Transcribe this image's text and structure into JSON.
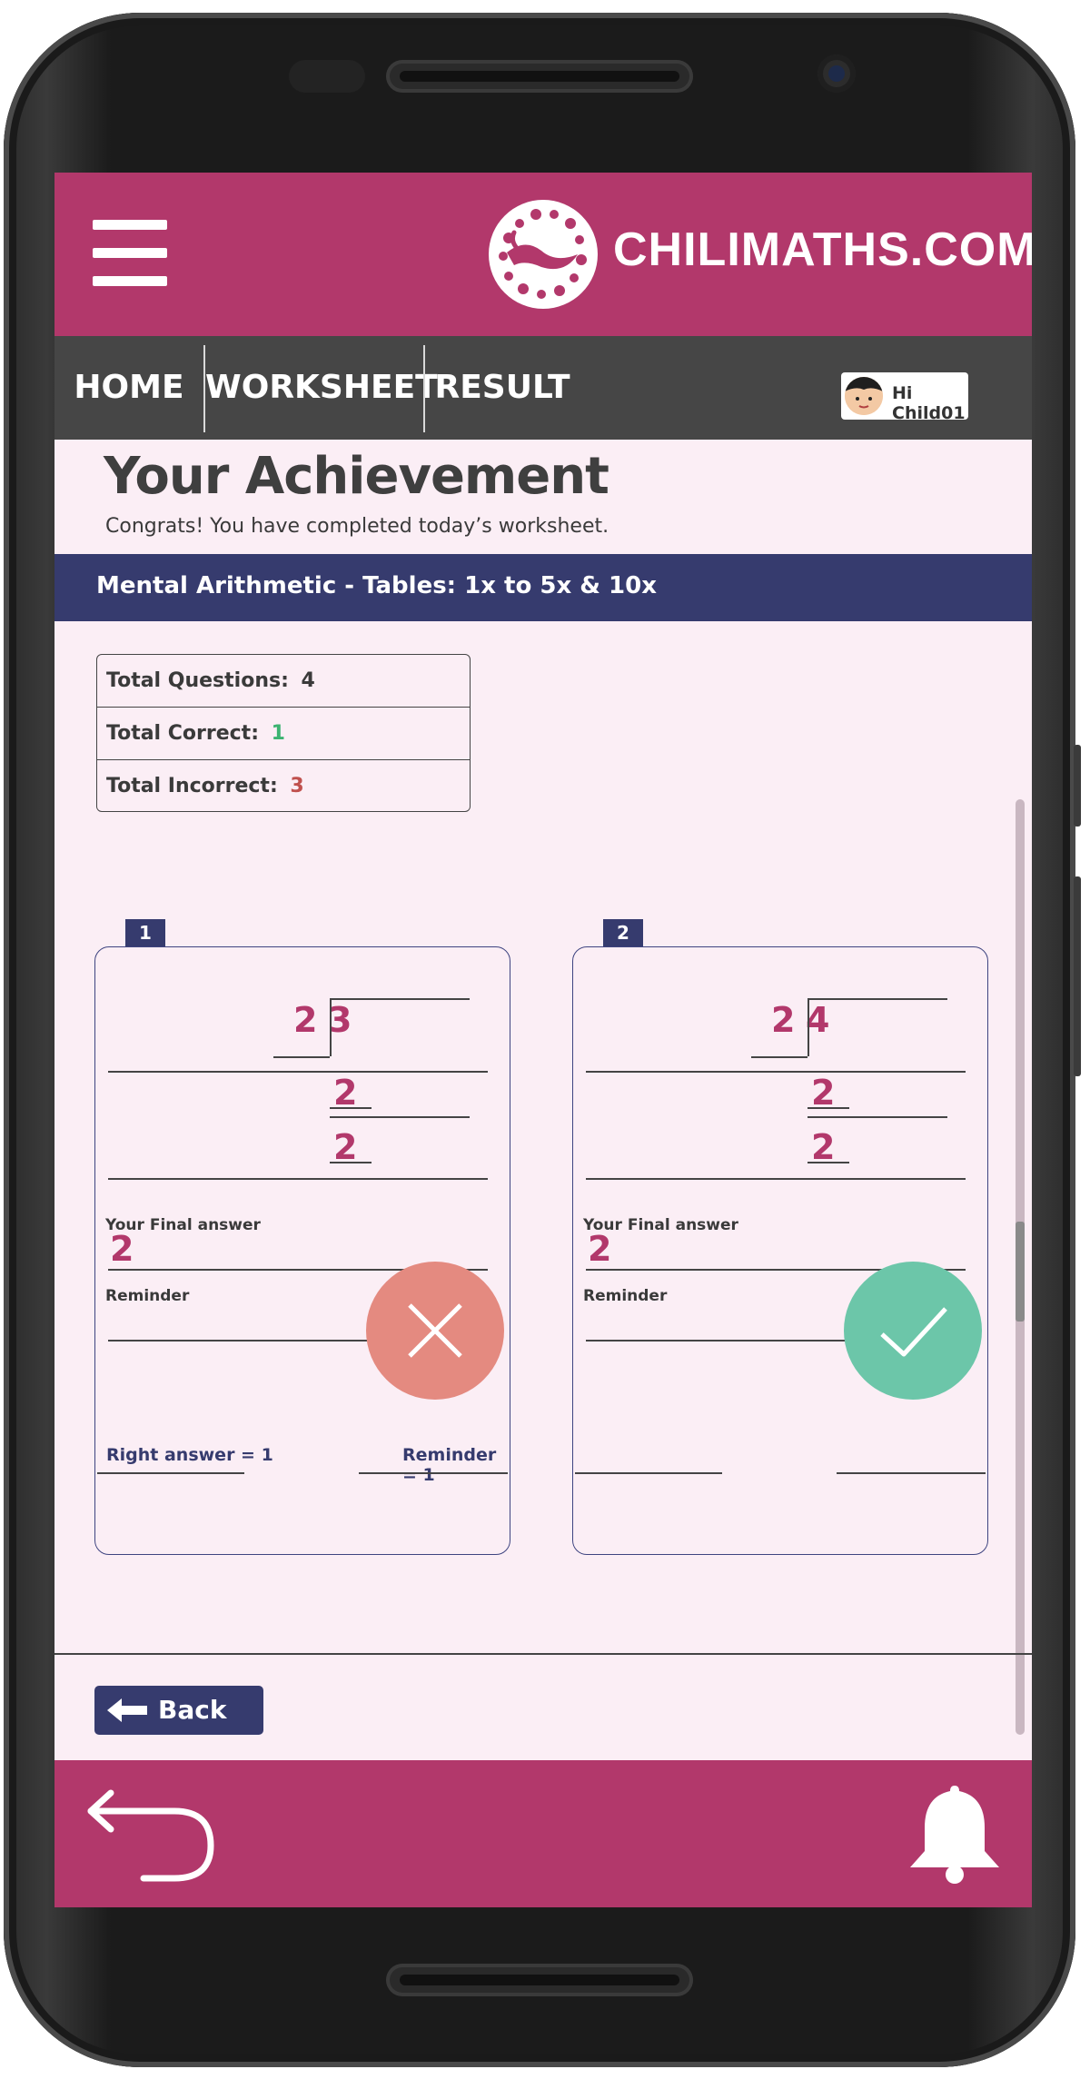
{
  "header": {
    "brand": "CHILIMATHS.COM"
  },
  "nav": {
    "items": [
      {
        "label": "HOME"
      },
      {
        "label": "WORKSHEET"
      },
      {
        "label": "RESULT"
      }
    ],
    "user_greeting": "Hi Child01"
  },
  "page": {
    "title": "Your Achievement",
    "subtitle": "Congrats! You have completed today’s worksheet.",
    "section_title": "Mental Arithmetic - Tables: 1x to 5x & 10x"
  },
  "summary": {
    "total_questions_label": "Total Questions:",
    "total_questions": "4",
    "total_correct_label": "Total Correct:",
    "total_correct": "1",
    "total_incorrect_label": "Total Incorrect:",
    "total_incorrect": "3",
    "correct_color": "#3cb371",
    "incorrect_color": "#c0504d"
  },
  "questions": [
    {
      "number": "1",
      "divisor": "2",
      "dividend": "3",
      "step1": "2",
      "step2": "2",
      "final_answer_label": "Your Final answer",
      "final_answer": "2",
      "reminder_label": "Reminder",
      "status": "incorrect",
      "right_answer": "Right answer = 1",
      "right_reminder": "Reminder = 1"
    },
    {
      "number": "2",
      "divisor": "2",
      "dividend": "4",
      "step1": "2",
      "step2": "2",
      "final_answer_label": "Your Final answer",
      "final_answer": "2",
      "reminder_label": "Reminder",
      "status": "correct"
    }
  ],
  "footer": {
    "back_label": "Back"
  },
  "colors": {
    "brand": "#b2386b",
    "nav_bg": "#464646",
    "section_bg": "#363b6e",
    "page_bg": "#fbeef5",
    "incorrect_badge": "#e48a80",
    "correct_badge": "#6cc6a9"
  }
}
